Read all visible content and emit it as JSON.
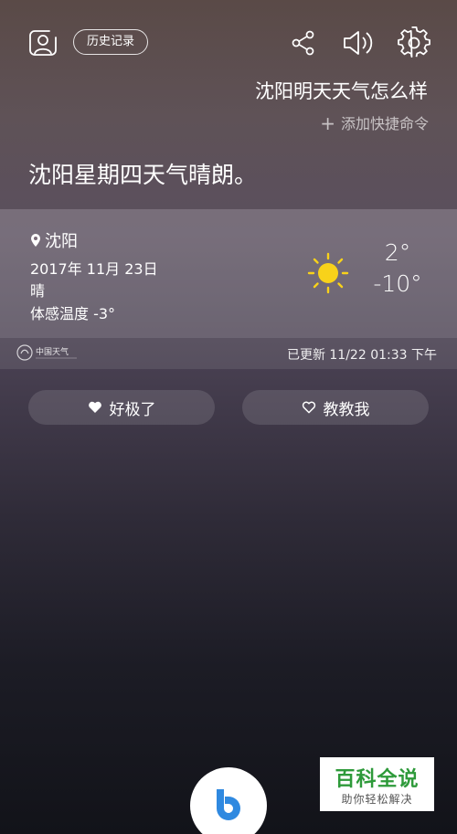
{
  "header": {
    "profile_icon": "profile-icon",
    "history_label": "历史记录",
    "share_icon": "share-icon",
    "volume_icon": "volume-icon",
    "settings_icon": "settings-icon"
  },
  "conversation": {
    "user_query": "沈阳明天天气怎么样",
    "add_command_label": "添加快捷命令",
    "answer": "沈阳星期四天气晴朗。"
  },
  "weather": {
    "location": "沈阳",
    "date": "2017年 11月 23日",
    "condition": "晴",
    "feels_like": "体感温度 -3°",
    "icon": "sun-icon",
    "high": "2°",
    "low": "-10°",
    "source_logo": "中国天气",
    "updated": "已更新  11/22 01:33 下午",
    "sun_color": "#f8d21a"
  },
  "feedback": {
    "great_label": "好极了",
    "teach_label": "教教我"
  },
  "watermark": {
    "title": "百科全说",
    "subtitle": "助你轻松解决",
    "color": "#2e9a3a"
  },
  "bixby": {
    "icon": "bixby-icon",
    "color": "#2f89e0"
  }
}
